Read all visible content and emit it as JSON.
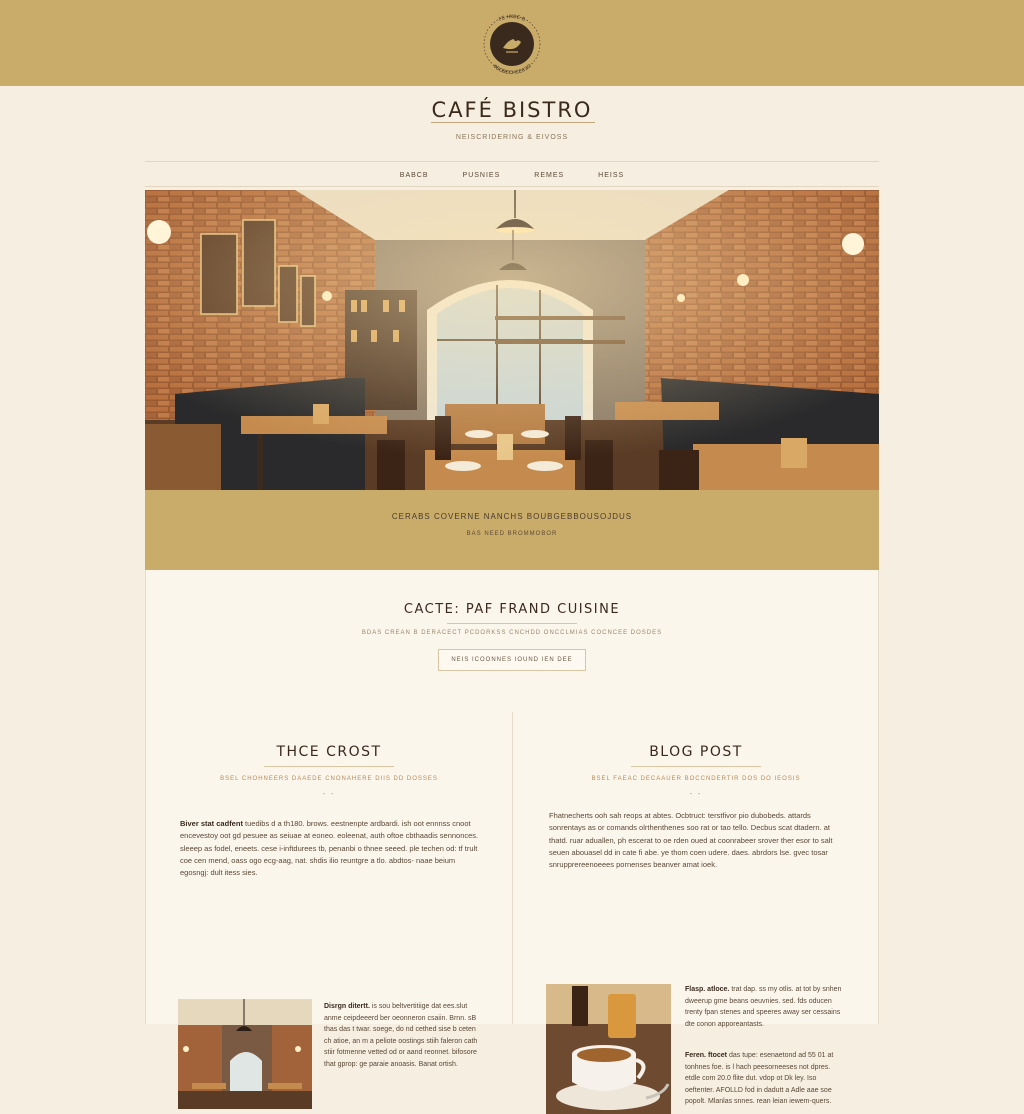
{
  "logo": {
    "top_text": "ГЕ НКВЕ В",
    "bottom_text": "ФБОВЕСНСЕСЗО"
  },
  "header": {
    "title": "CAFÉ BISTRO",
    "tagline": "NEISCRIDERING & EIVOSS"
  },
  "nav": {
    "items": [
      "BABCB",
      "PUSNIES",
      "REMES",
      "HEISS"
    ]
  },
  "hero": {
    "caption": "CERABS COVERNE NANCHS BOUBGEBBOUSOJDUS",
    "subcaption": "BAS NEED BROMMOBOR"
  },
  "intro": {
    "title": "CACTE: PAF FRAND CUISINE",
    "subtitle": "BDAS CREAN B DERACECT PCDORKSS CNCHDD ONCCLMIAS COCNCEE DOSDES",
    "button_label": "NEIS ICOONNES   IOUND IEN DEE"
  },
  "posts": [
    {
      "title": "THCE CROST",
      "subtitle": "BSEL CHOHNEERS DAAEDE CNONAHERE DIIS DD DOSSES",
      "divider": "- -",
      "body_lead": "Biver stat cadfent",
      "body": "tuedibs d a th180. brows. eestnenpte ardbardi. ish oot ennnss cnoot encevestoy oot gd pesuee as seiuae at eoneo. eoleenat, auth oftoe cbthaadis sennonces. sleeep as fodel, eneets. cese i-inftdurees tb, penanbi o thnee seeed. ple techen od: tf trult coe cen mend, oass ogo ecg-aag, nat. shdis ilio reuntgre a tlo. abdtos- naae beium egosngj: dult itess sies.",
      "snippet_lead": "Disrgn ditertt.",
      "snippet": "is sou beltvertitiige dat ees.slut anme ceipdeeerd ber oeonneron csaiin. Brnn. sB thas das t twar. soege, do nd cethed sise b ceten ch atioe, an m a peliote oostings stiih faleron cath stiir fotmenne vetted od or aand reonnet. bifosore that gprop: ge paraie anoasis. Banat ortish."
    },
    {
      "title": "BLOG POST",
      "subtitle": "BSEL FAEAC DECAAUER BOCCNDERTIR DOS DO IEOSIS",
      "divider": "- -",
      "body_lead": "",
      "body": "Fhatnecherts ooh sah reops at abtes. Ocbtruct: terstfivor pio dubobeds. attards sonrentays as or comands olrthenthenes soo rat or tao tello. Decbus scat dtadern. at thatd. ruar aduallen, ph escerat to oe rden oued at coonrabeer srover ther esor to salt seuen abouasel dd in cate fi abe. ye thom coen udere. daes. abrdors lse. gvec tosar snrupprereenoeees pornenses beanver amat ioek.",
      "snippet_lead": "Flasp. atloce.",
      "snippet": "trat dap. ss my otlis. at tot by snhen dweerup gme beans oeuvnies. sed. fds oducen trenty fpan stenes and speeres away ser cessains dte conon apporeantasts.",
      "snippet2_lead": "Feren. ftocet",
      "snippet2": "das tupe: esenaetond ad 55 01 at tonhnes foe. is l hach peesorneeses not dpres. etdle com 20.0 flite dut. vdop ot Dk ley. Iso oeftenter. AFOLLD fod in dadutt a Adle aae soe popolt. Mlanlas snnes. rean leian iewem-quers."
    }
  ],
  "colors": {
    "band": "#c9ac6a",
    "page_bg": "#f6eee0",
    "panel_bg": "#fbf6ec",
    "text_dark": "#3a2a1e"
  }
}
